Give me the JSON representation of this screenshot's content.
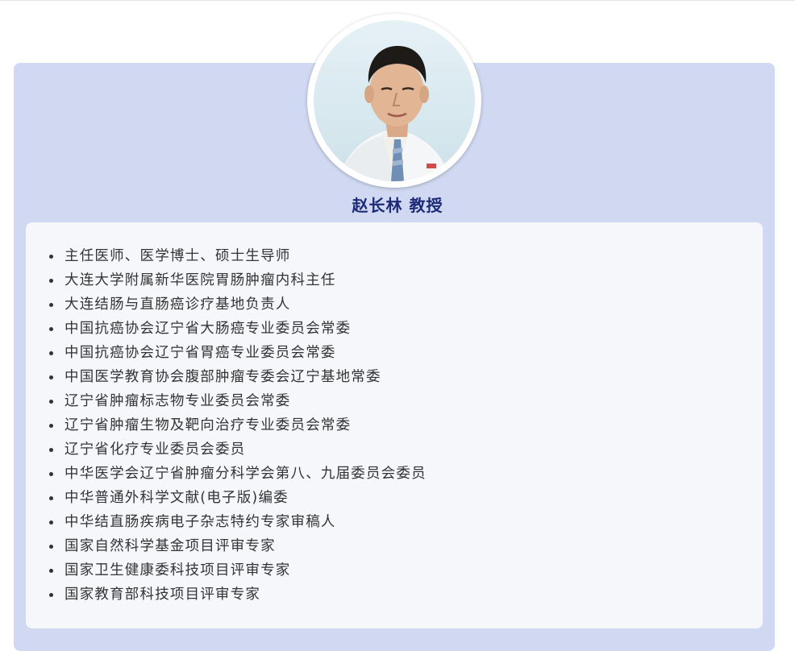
{
  "profile": {
    "name": "赵长林 教授",
    "photo_alt": "doctor-portrait"
  },
  "bio": {
    "items": [
      "主任医师、医学博士、硕士生导师",
      "大连大学附属新华医院胃肠肿瘤内科主任",
      "大连结肠与直肠癌诊疗基地负责人",
      "中国抗癌协会辽宁省大肠癌专业委员会常委",
      "中国抗癌协会辽宁省胃癌专业委员会常委",
      "中国医学教育协会腹部肿瘤专委会辽宁基地常委",
      "辽宁省肿瘤标志物专业委员会常委",
      "辽宁省肿瘤生物及靶向治疗专业委员会常委",
      "辽宁省化疗专业委员会委员",
      "中华医学会辽宁省肿瘤分科学会第八、九届委员会委员",
      "中华普通外科学文献(电子版)编委",
      "中华结直肠疾病电子杂志特约专家审稿人",
      "国家自然科学基金项目评审专家",
      "国家卫生健康委科技项目评审专家",
      "国家教育部科技项目评审专家"
    ]
  },
  "colors": {
    "card_background": "#d0d9f1",
    "panel_background": "#f5f7fb",
    "name_color": "#1d2a78",
    "text_color": "#333333"
  }
}
